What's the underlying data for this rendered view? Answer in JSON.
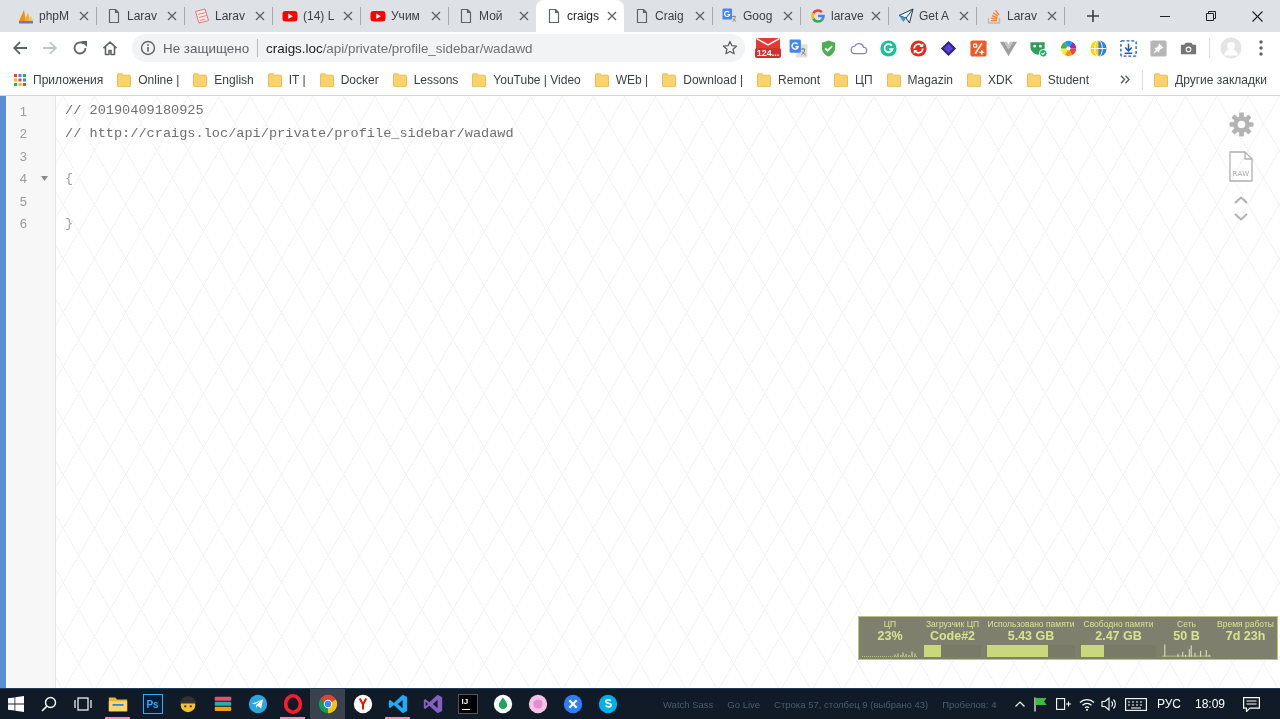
{
  "browser": {
    "tabs": [
      {
        "kind": "pma",
        "title": "phpM",
        "selected": false
      },
      {
        "kind": "page",
        "title": "Larav",
        "selected": false
      },
      {
        "kind": "sketch",
        "title": "Larav",
        "selected": false
      },
      {
        "kind": "youtube",
        "title": "(14) L",
        "selected": false
      },
      {
        "kind": "youtube",
        "title": "Учим",
        "selected": false
      },
      {
        "kind": "page",
        "title": "Мой",
        "selected": false
      },
      {
        "kind": "page",
        "title": "craigs",
        "selected": true
      },
      {
        "kind": "page",
        "title": "Craig",
        "selected": false
      },
      {
        "kind": "translate",
        "title": "Goog",
        "selected": false
      },
      {
        "kind": "google",
        "title": "larave",
        "selected": false
      },
      {
        "kind": "plane",
        "title": "Get A",
        "selected": false
      },
      {
        "kind": "stack",
        "title": "Larav",
        "selected": false
      }
    ],
    "nav": [
      {
        "kind": "back",
        "disabled": false
      },
      {
        "kind": "forward",
        "disabled": true
      },
      {
        "kind": "reload",
        "disabled": false
      },
      {
        "kind": "home",
        "disabled": false
      }
    ],
    "address_bar": {
      "security_label": "Не защищено",
      "host": "craigs.loc",
      "path": "/api/private/profile_sidebar/wadawd",
      "bookmarked": false
    },
    "extensions": [
      {
        "kind": "mail",
        "badge": "124..."
      },
      {
        "kind": "translate"
      },
      {
        "kind": "shield"
      },
      {
        "kind": "cloud"
      },
      {
        "kind": "grammar"
      },
      {
        "kind": "sync"
      },
      {
        "kind": "layers"
      },
      {
        "kind": "percent"
      },
      {
        "kind": "vee"
      },
      {
        "kind": "mask"
      },
      {
        "kind": "wheel"
      },
      {
        "kind": "globe"
      },
      {
        "kind": "download"
      },
      {
        "kind": "pin"
      },
      {
        "kind": "camera"
      }
    ],
    "bookmarks": {
      "apps_label": "Приложения",
      "items": [
        {
          "label": "Online |"
        },
        {
          "label": "English"
        },
        {
          "label": "IT |"
        },
        {
          "label": "Docker"
        },
        {
          "label": "Lessons"
        },
        {
          "label": "YouTube | Video"
        },
        {
          "label": "WEb |"
        },
        {
          "label": "Download |"
        },
        {
          "label": "Remont"
        },
        {
          "label": "ЦП"
        },
        {
          "label": "Magazin"
        },
        {
          "label": "XDK"
        },
        {
          "label": "Student"
        }
      ],
      "other_label": "Другие закладки"
    }
  },
  "viewer": {
    "lines": [
      {
        "number": "1",
        "kind": "comment",
        "text": "// 20190409180925",
        "foldable": false
      },
      {
        "number": "2",
        "kind": "comment",
        "text": "// http://craigs.loc/api/private/profile_sidebar/wadawd",
        "foldable": false
      },
      {
        "number": "3",
        "kind": "blank",
        "foldable": false
      },
      {
        "number": "4",
        "kind": "brace",
        "text": "{",
        "foldable": true
      },
      {
        "number": "5",
        "kind": "blank",
        "foldable": false
      },
      {
        "number": "6",
        "kind": "brace",
        "text": "}",
        "foldable": false
      }
    ],
    "raw_label": "RAW"
  },
  "system_monitor": {
    "columns": [
      {
        "label": "ЦП",
        "value": "23%",
        "kind": "cpu_graph"
      },
      {
        "label": "Загрузчик ЦП",
        "value": "Code#2",
        "kind": "bar",
        "level": 0.29
      },
      {
        "label": "Использовано памяти",
        "value": "5.43 GB",
        "kind": "bar",
        "level": 0.69
      },
      {
        "label": "Свободно памяти",
        "value": "2.47 GB",
        "kind": "bar",
        "level": 0.31
      },
      {
        "label": "Сеть",
        "value": "50 B",
        "kind": "net_graph"
      },
      {
        "label": "Время работы",
        "value": "7d 23h",
        "kind": "plain"
      }
    ]
  },
  "taskbar": {
    "apps": [
      {
        "kind": "explorer",
        "running": true,
        "selected": false
      },
      {
        "kind": "photoshop",
        "glyph": "Ps",
        "running": false,
        "selected": false
      },
      {
        "kind": "face",
        "running": false,
        "selected": false
      },
      {
        "kind": "books",
        "running": false,
        "selected": false
      },
      {
        "kind": "telegram",
        "running": false,
        "selected": false
      },
      {
        "kind": "opera",
        "running": true,
        "selected": false
      },
      {
        "kind": "chrome",
        "running": false,
        "selected": true
      },
      {
        "kind": "yandex",
        "running": false,
        "selected": false
      },
      {
        "kind": "vscode",
        "running": true,
        "selected": false
      },
      {
        "kind": "vstudio",
        "running": false,
        "selected": false
      },
      {
        "kind": "jetbrains",
        "glyph": "IJ",
        "running": false,
        "selected": false
      },
      {
        "kind": "droplet",
        "running": false,
        "selected": false
      },
      {
        "kind": "pink",
        "running": false,
        "selected": false
      },
      {
        "kind": "xcircle",
        "running": false,
        "selected": false
      },
      {
        "kind": "skype",
        "running": false,
        "selected": false
      }
    ],
    "status_texts": [
      "Watch Sass",
      "Go Live",
      "Строка 57, столбец 9 (выбрано 43)",
      "Пробелов: 4"
    ],
    "language": "РУС",
    "time": "18:09"
  }
}
